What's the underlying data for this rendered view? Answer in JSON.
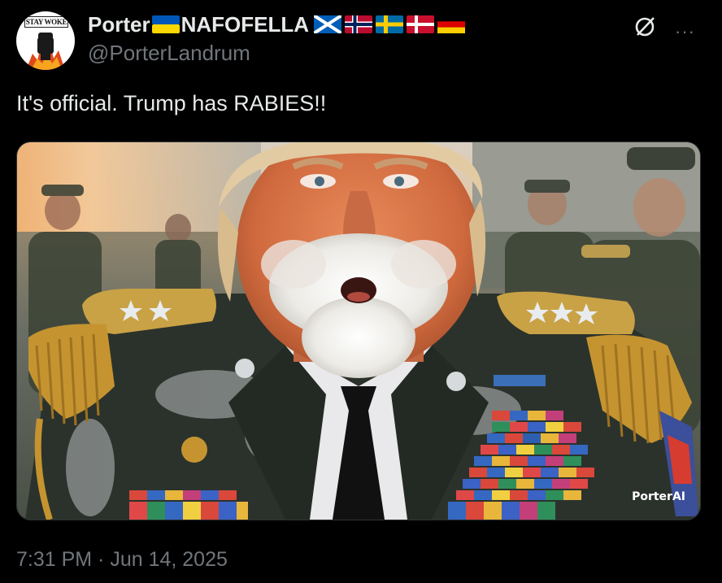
{
  "author": {
    "display_name": "Porter",
    "display_name_suffix": "NAFOFELLA",
    "handle": "@PorterLandrum",
    "avatar_text": "STAY WOKE",
    "flags": [
      "ukraine-flag",
      "scotland-flag",
      "norway-flag",
      "sweden-flag",
      "denmark-flag",
      "germany-flag"
    ]
  },
  "actions": {
    "grok_icon": "grok-icon",
    "more_label": "···"
  },
  "tweet": {
    "text": "It's official. Trump has RABIES!!",
    "media_watermark": "PorterAI",
    "timestamp": "7:31 PM · Jun 14, 2025"
  },
  "colors": {
    "background": "#000000",
    "primary_text": "#e7e9ea",
    "secondary_text": "#71767b"
  }
}
